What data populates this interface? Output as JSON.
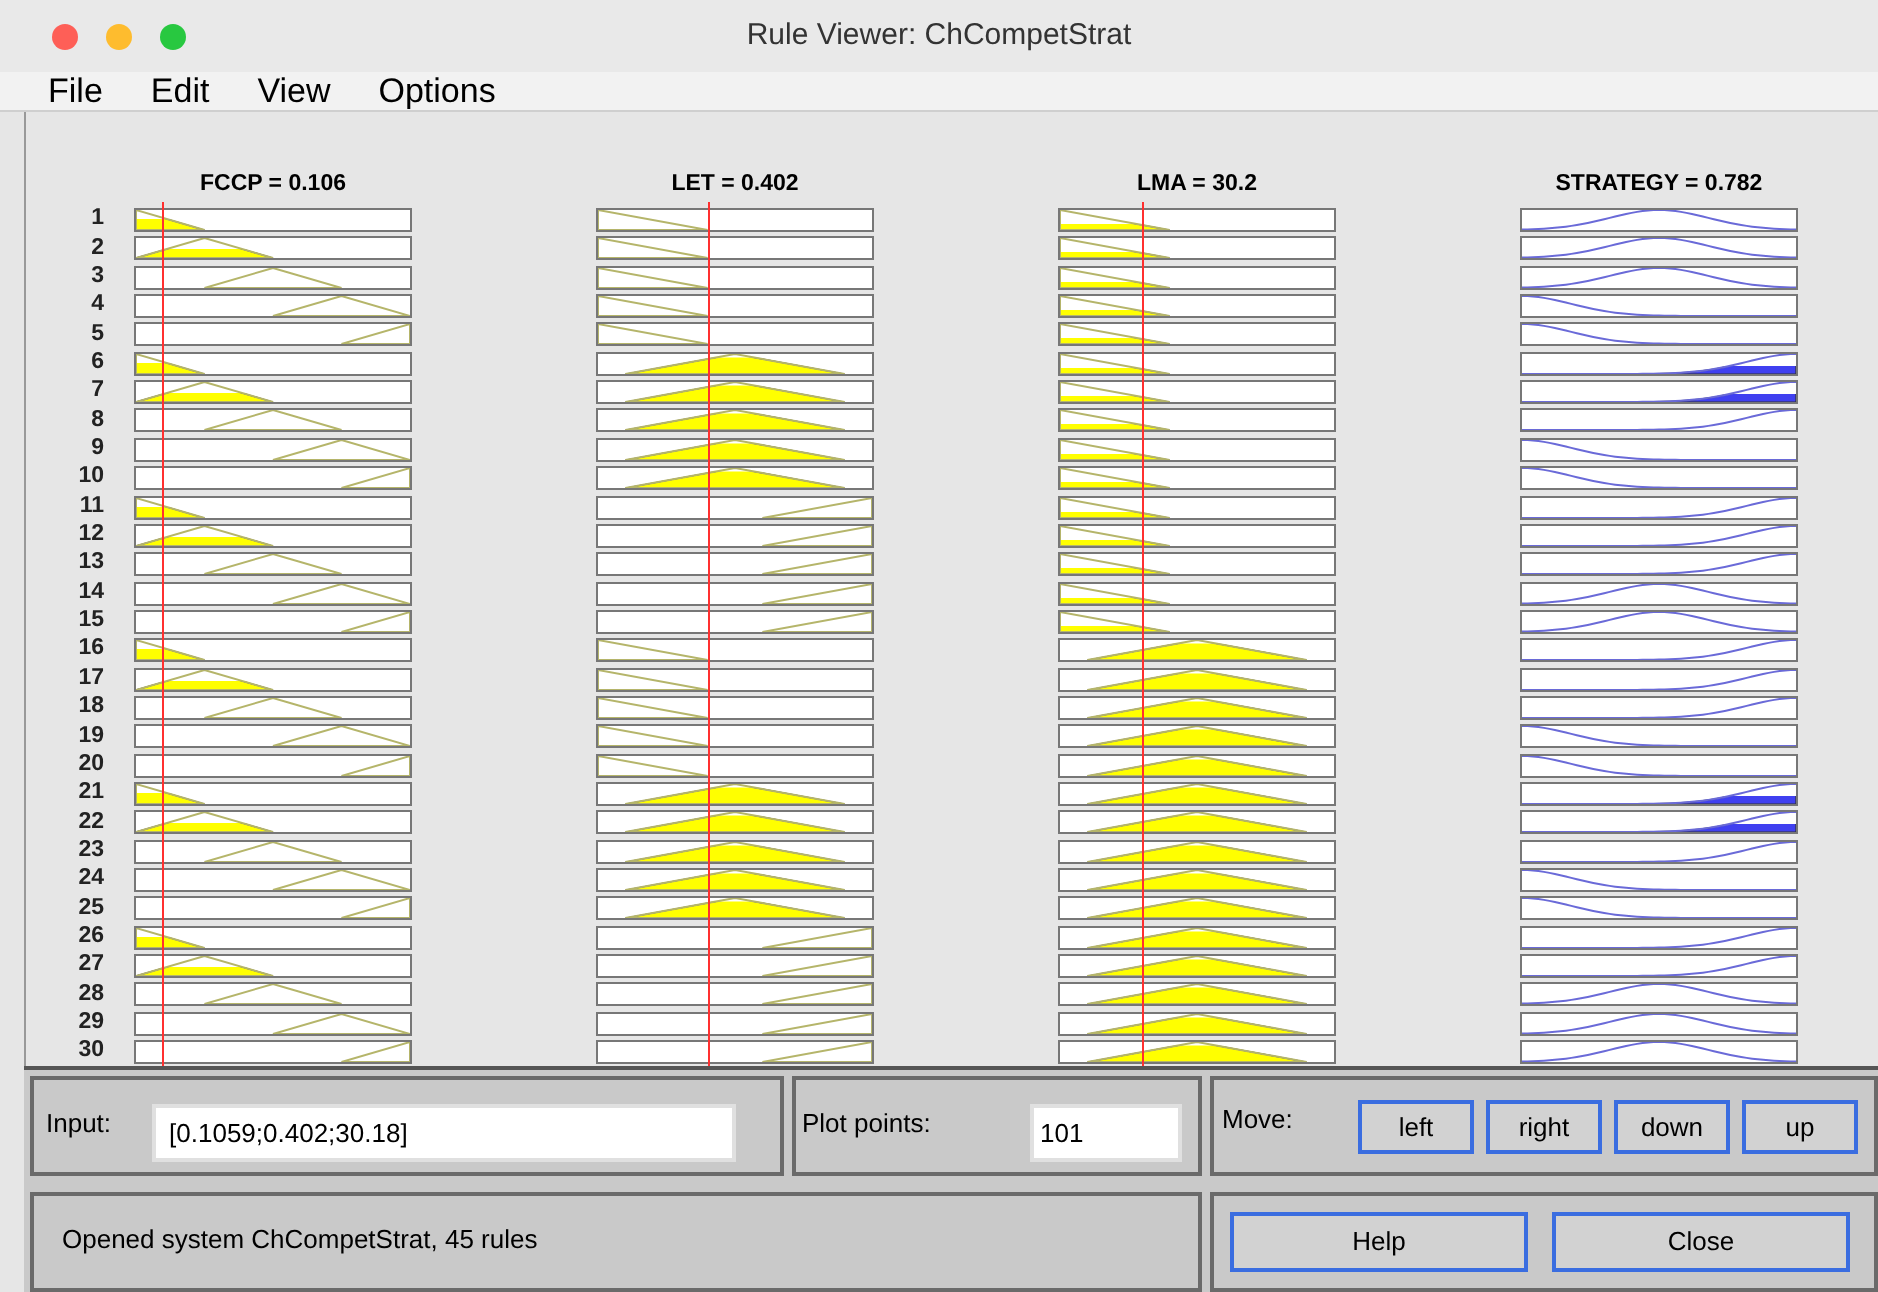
{
  "window": {
    "title": "Rule Viewer: ChCompetStrat"
  },
  "menu": [
    "File",
    "Edit",
    "View",
    "Options"
  ],
  "columns": [
    {
      "kind": "five-term",
      "label": "FCCP = 0.106",
      "level": 0.1
    },
    {
      "kind": "three-term",
      "label": "LET = 0.402",
      "level": 0.4
    },
    {
      "kind": "three-term",
      "label": "LMA = 30.2",
      "level": 0.3
    },
    {
      "kind": "output",
      "label": "STRATEGY = 0.782"
    }
  ],
  "rules": [
    {
      "number": "1",
      "cells": [
        {
          "kind": "very-low",
          "fired": true
        },
        {
          "kind": "low",
          "fired": false
        },
        {
          "kind": "low",
          "fired": true
        },
        {
          "kind": "medium",
          "fired": false
        }
      ]
    },
    {
      "number": "2",
      "cells": [
        {
          "kind": "low",
          "fired": true
        },
        {
          "kind": "low",
          "fired": false
        },
        {
          "kind": "low",
          "fired": true
        },
        {
          "kind": "medium",
          "fired": false
        }
      ]
    },
    {
      "number": "3",
      "cells": [
        {
          "kind": "medium",
          "fired": false
        },
        {
          "kind": "low",
          "fired": false
        },
        {
          "kind": "low",
          "fired": true
        },
        {
          "kind": "medium",
          "fired": false
        }
      ]
    },
    {
      "number": "4",
      "cells": [
        {
          "kind": "high",
          "fired": false
        },
        {
          "kind": "low",
          "fired": false
        },
        {
          "kind": "low",
          "fired": true
        },
        {
          "kind": "low",
          "fired": false
        }
      ]
    },
    {
      "number": "5",
      "cells": [
        {
          "kind": "very-high",
          "fired": false
        },
        {
          "kind": "low",
          "fired": false
        },
        {
          "kind": "low",
          "fired": true
        },
        {
          "kind": "low",
          "fired": false
        }
      ]
    },
    {
      "number": "6",
      "cells": [
        {
          "kind": "very-low",
          "fired": true
        },
        {
          "kind": "medium",
          "fired": true
        },
        {
          "kind": "low",
          "fired": true
        },
        {
          "kind": "high",
          "fired": true
        }
      ]
    },
    {
      "number": "7",
      "cells": [
        {
          "kind": "low",
          "fired": true
        },
        {
          "kind": "medium",
          "fired": true
        },
        {
          "kind": "low",
          "fired": true
        },
        {
          "kind": "high",
          "fired": true
        }
      ]
    },
    {
      "number": "8",
      "cells": [
        {
          "kind": "medium",
          "fired": false
        },
        {
          "kind": "medium",
          "fired": true
        },
        {
          "kind": "low",
          "fired": true
        },
        {
          "kind": "high",
          "fired": false
        }
      ]
    },
    {
      "number": "9",
      "cells": [
        {
          "kind": "high",
          "fired": false
        },
        {
          "kind": "medium",
          "fired": true
        },
        {
          "kind": "low",
          "fired": true
        },
        {
          "kind": "low",
          "fired": false
        }
      ]
    },
    {
      "number": "10",
      "cells": [
        {
          "kind": "very-high",
          "fired": false
        },
        {
          "kind": "medium",
          "fired": true
        },
        {
          "kind": "low",
          "fired": true
        },
        {
          "kind": "low",
          "fired": false
        }
      ]
    },
    {
      "number": "11",
      "cells": [
        {
          "kind": "very-low",
          "fired": true
        },
        {
          "kind": "high",
          "fired": false
        },
        {
          "kind": "low",
          "fired": true
        },
        {
          "kind": "high",
          "fired": false
        }
      ]
    },
    {
      "number": "12",
      "cells": [
        {
          "kind": "low",
          "fired": true
        },
        {
          "kind": "high",
          "fired": false
        },
        {
          "kind": "low",
          "fired": true
        },
        {
          "kind": "high",
          "fired": false
        }
      ]
    },
    {
      "number": "13",
      "cells": [
        {
          "kind": "medium",
          "fired": false
        },
        {
          "kind": "high",
          "fired": false
        },
        {
          "kind": "low",
          "fired": true
        },
        {
          "kind": "high",
          "fired": false
        }
      ]
    },
    {
      "number": "14",
      "cells": [
        {
          "kind": "high",
          "fired": false
        },
        {
          "kind": "high",
          "fired": false
        },
        {
          "kind": "low",
          "fired": true
        },
        {
          "kind": "medium",
          "fired": false
        }
      ]
    },
    {
      "number": "15",
      "cells": [
        {
          "kind": "very-high",
          "fired": false
        },
        {
          "kind": "high",
          "fired": false
        },
        {
          "kind": "low",
          "fired": true
        },
        {
          "kind": "medium",
          "fired": false
        }
      ]
    },
    {
      "number": "16",
      "cells": [
        {
          "kind": "very-low",
          "fired": true
        },
        {
          "kind": "low",
          "fired": false
        },
        {
          "kind": "medium",
          "fired": true
        },
        {
          "kind": "high",
          "fired": false
        }
      ]
    },
    {
      "number": "17",
      "cells": [
        {
          "kind": "low",
          "fired": true
        },
        {
          "kind": "low",
          "fired": false
        },
        {
          "kind": "medium",
          "fired": true
        },
        {
          "kind": "high",
          "fired": false
        }
      ]
    },
    {
      "number": "18",
      "cells": [
        {
          "kind": "medium",
          "fired": false
        },
        {
          "kind": "low",
          "fired": false
        },
        {
          "kind": "medium",
          "fired": true
        },
        {
          "kind": "high",
          "fired": false
        }
      ]
    },
    {
      "number": "19",
      "cells": [
        {
          "kind": "high",
          "fired": false
        },
        {
          "kind": "low",
          "fired": false
        },
        {
          "kind": "medium",
          "fired": true
        },
        {
          "kind": "low",
          "fired": false
        }
      ]
    },
    {
      "number": "20",
      "cells": [
        {
          "kind": "very-high",
          "fired": false
        },
        {
          "kind": "low",
          "fired": false
        },
        {
          "kind": "medium",
          "fired": true
        },
        {
          "kind": "low",
          "fired": false
        }
      ]
    },
    {
      "number": "21",
      "cells": [
        {
          "kind": "very-low",
          "fired": true
        },
        {
          "kind": "medium",
          "fired": true
        },
        {
          "kind": "medium",
          "fired": true
        },
        {
          "kind": "high",
          "fired": true
        }
      ]
    },
    {
      "number": "22",
      "cells": [
        {
          "kind": "low",
          "fired": true
        },
        {
          "kind": "medium",
          "fired": true
        },
        {
          "kind": "medium",
          "fired": true
        },
        {
          "kind": "high",
          "fired": true
        }
      ]
    },
    {
      "number": "23",
      "cells": [
        {
          "kind": "medium",
          "fired": false
        },
        {
          "kind": "medium",
          "fired": true
        },
        {
          "kind": "medium",
          "fired": true
        },
        {
          "kind": "high",
          "fired": false
        }
      ]
    },
    {
      "number": "24",
      "cells": [
        {
          "kind": "high",
          "fired": false
        },
        {
          "kind": "medium",
          "fired": true
        },
        {
          "kind": "medium",
          "fired": true
        },
        {
          "kind": "low",
          "fired": false
        }
      ]
    },
    {
      "number": "25",
      "cells": [
        {
          "kind": "very-high",
          "fired": false
        },
        {
          "kind": "medium",
          "fired": true
        },
        {
          "kind": "medium",
          "fired": true
        },
        {
          "kind": "low",
          "fired": false
        }
      ]
    },
    {
      "number": "26",
      "cells": [
        {
          "kind": "very-low",
          "fired": true
        },
        {
          "kind": "high",
          "fired": false
        },
        {
          "kind": "medium",
          "fired": true
        },
        {
          "kind": "high",
          "fired": false
        }
      ]
    },
    {
      "number": "27",
      "cells": [
        {
          "kind": "low",
          "fired": true
        },
        {
          "kind": "high",
          "fired": false
        },
        {
          "kind": "medium",
          "fired": true
        },
        {
          "kind": "high",
          "fired": false
        }
      ]
    },
    {
      "number": "28",
      "cells": [
        {
          "kind": "medium",
          "fired": false
        },
        {
          "kind": "high",
          "fired": false
        },
        {
          "kind": "medium",
          "fired": true
        },
        {
          "kind": "medium",
          "fired": false
        }
      ]
    },
    {
      "number": "29",
      "cells": [
        {
          "kind": "high",
          "fired": false
        },
        {
          "kind": "high",
          "fired": false
        },
        {
          "kind": "medium",
          "fired": true
        },
        {
          "kind": "medium",
          "fired": false
        }
      ]
    },
    {
      "number": "30",
      "cells": [
        {
          "kind": "very-high",
          "fired": false
        },
        {
          "kind": "high",
          "fired": false
        },
        {
          "kind": "medium",
          "fired": true
        },
        {
          "kind": "medium",
          "fired": false
        }
      ]
    }
  ],
  "input": {
    "label": "Input:",
    "value": "[0.1059;0.402;30.18]"
  },
  "plot_points": {
    "label": "Plot points:",
    "value": "101"
  },
  "move": {
    "label": "Move:",
    "buttons": [
      "left",
      "right",
      "down",
      "up"
    ]
  },
  "status": "Opened system ChCompetStrat, 45 rules",
  "buttons": [
    "Help",
    "Close"
  ]
}
